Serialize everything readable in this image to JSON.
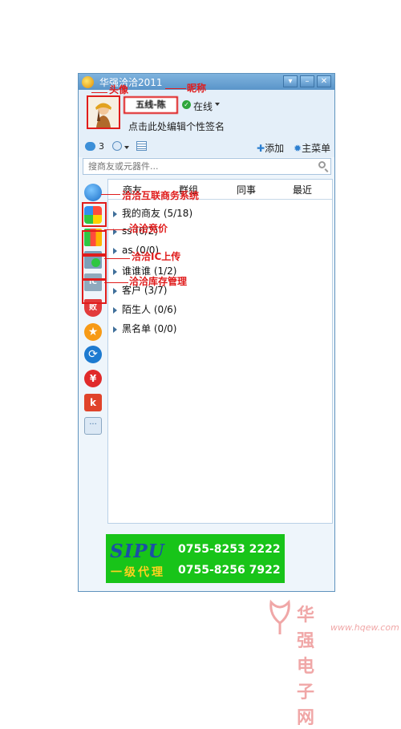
{
  "window": {
    "title": "华强洽洽2011"
  },
  "header": {
    "nickname": "五线-陈",
    "status": "在线",
    "signature": "点击此处编辑个性签名"
  },
  "toolbar": {
    "message_count": "3",
    "add_label": "添加",
    "main_menu_label": "主菜单"
  },
  "search": {
    "placeholder": "搜商友或元器件..."
  },
  "tabs": [
    "商友",
    "群组",
    "同事",
    "最近"
  ],
  "groups": [
    {
      "label": "我的商友 (5/18)"
    },
    {
      "label": "ss (0/2)"
    },
    {
      "label": "as (0/0)"
    },
    {
      "label": "谁谁谁 (1/2)"
    },
    {
      "label": "客户 (3/7)"
    },
    {
      "label": "陌生人 (0/6)"
    },
    {
      "label": "黑名单 (0/0)"
    }
  ],
  "sidebar_icons": [
    "chat-bubble-icon",
    "colorful-squares-icon",
    "bar-chart-icon",
    "upload-arrow-icon",
    "ic-chip-icon",
    "shield-badge-icon",
    "star-badge-icon",
    "refresh-arrows-icon",
    "yen-coin-icon",
    "k-app-icon",
    "message-dots-icon"
  ],
  "annotations": {
    "avatar": "头像",
    "nickname": "昵称",
    "business_system": "洽洽互联商务系统",
    "bidding": "洽洽竞价",
    "ic_upload": "洽洽IC上传",
    "inventory": "洽洽库存管理"
  },
  "ad": {
    "logo": "SIPU",
    "phone1": "0755-8253 2222",
    "agent": "一级代理",
    "phone2": "0755-8256 7922"
  },
  "watermark": {
    "text": "华强电子网",
    "url": "www.hqew.com"
  },
  "colors": {
    "accent_red": "#e01c1c",
    "title_blue": "#5a95c9",
    "ad_green": "#18c419"
  }
}
